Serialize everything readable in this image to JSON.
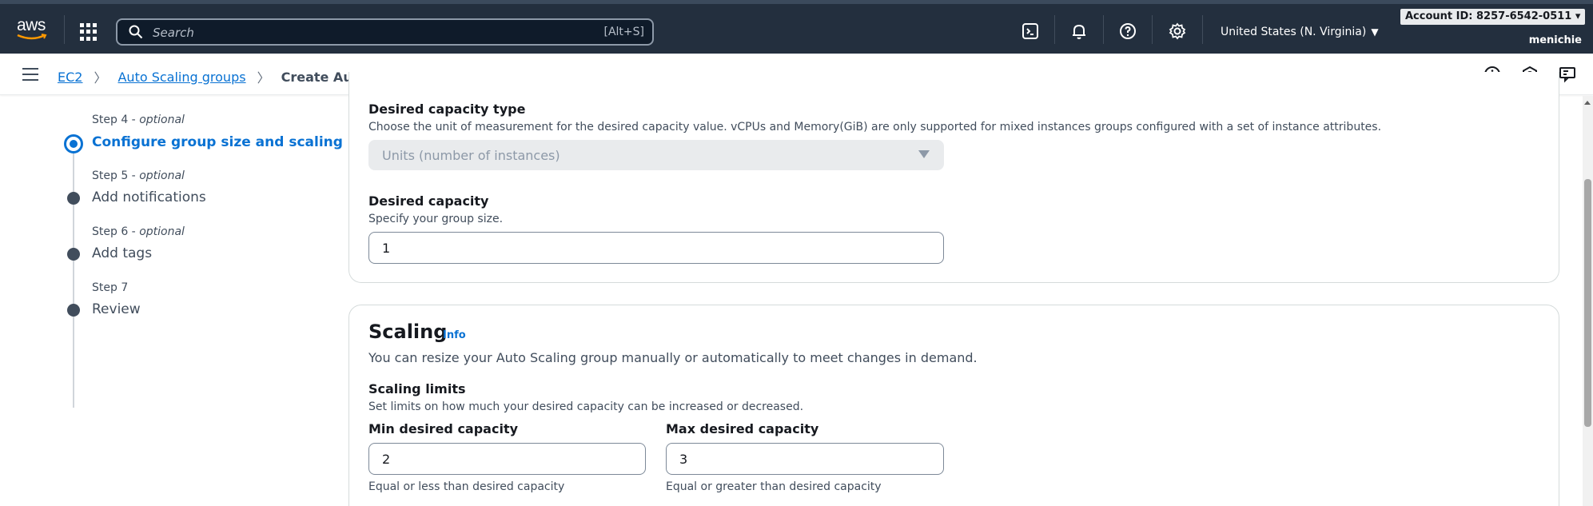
{
  "topnav": {
    "logo_text": "aws",
    "search_placeholder": "Search",
    "search_shortcut": "[Alt+S]",
    "icons": [
      "cloudshell-icon",
      "bell-icon",
      "help-icon",
      "settings-icon"
    ],
    "region": "United States (N. Virginia)",
    "account": "Account ID: 8257-6542-0511",
    "user": "menichie"
  },
  "breadcrumb": {
    "items": [
      {
        "label": "EC2",
        "link": true
      },
      {
        "label": "Auto Scaling groups",
        "link": true
      },
      {
        "label": "Create Auto Scaling group",
        "link": false
      }
    ],
    "tools": [
      "info-circle-icon",
      "hexagon-icon",
      "feedback-icon"
    ]
  },
  "steps": [
    {
      "step": "Step 4",
      "optional": "optional",
      "title": "Configure group size and scaling",
      "active": true
    },
    {
      "step": "Step 5",
      "optional": "optional",
      "title": "Add notifications",
      "active": false
    },
    {
      "step": "Step 6",
      "optional": "optional",
      "title": "Add tags",
      "active": false
    },
    {
      "step": "Step 7",
      "optional": "",
      "title": "Review",
      "active": false
    }
  ],
  "group_size": {
    "type_label": "Desired capacity type",
    "type_desc": "Choose the unit of measurement for the desired capacity value. vCPUs and Memory(GiB) are only supported for mixed instances groups configured with a set of instance attributes.",
    "type_value": "Units (number of instances)",
    "capacity_label": "Desired capacity",
    "capacity_desc": "Specify your group size.",
    "capacity_value": "1"
  },
  "scaling": {
    "title": "Scaling",
    "info": "Info",
    "desc": "You can resize your Auto Scaling group manually or automatically to meet changes in demand.",
    "limits_label": "Scaling limits",
    "limits_desc": "Set limits on how much your desired capacity can be increased or decreased.",
    "min_label": "Min desired capacity",
    "min_value": "2",
    "min_hint": "Equal or less than desired capacity",
    "max_label": "Max desired capacity",
    "max_value": "3",
    "max_hint": "Equal or greater than desired capacity"
  },
  "colors": {
    "nav_bg": "#232f3e",
    "link": "#0972d3",
    "text": "#16191f"
  }
}
